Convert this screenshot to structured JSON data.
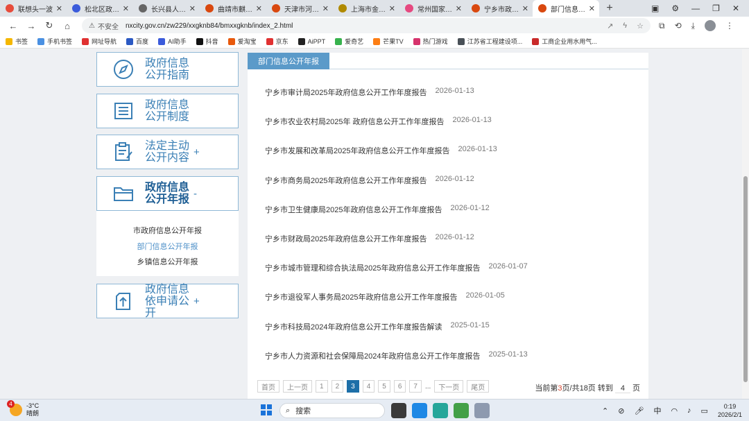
{
  "browser": {
    "tabs": [
      {
        "title": "联想头一波",
        "color": "#e74c3c"
      },
      {
        "title": "松北区政府办公",
        "color": "#3b5bdb"
      },
      {
        "title": "长兴县人民政府",
        "color": "#666666"
      },
      {
        "title": "曲靖市麒麟区",
        "color": "#d9480f"
      },
      {
        "title": "天津市河西区",
        "color": "#d9480f"
      },
      {
        "title": "上海市金山区",
        "color": "#b08a00"
      },
      {
        "title": "常州国家高新区",
        "color": "#e64980"
      },
      {
        "title": "宁乡市政府门户",
        "color": "#d9480f"
      },
      {
        "title": "部门信息公开年报",
        "color": "#d9480f",
        "active": true
      }
    ],
    "new_tab": "+",
    "address": {
      "insecure_label": "不安全",
      "url": "nxcity.gov.cn/zw229/xxgknb84/bmxxgknb/index_2.html"
    },
    "bookmarks": [
      {
        "label": "书签",
        "color": "#f5b700"
      },
      {
        "label": "手机书签",
        "color": "#4a90e2"
      },
      {
        "label": "网址导航",
        "color": "#e03131"
      },
      {
        "label": "百度",
        "color": "#2b59c3"
      },
      {
        "label": "AI助手",
        "color": "#3b5bdb"
      },
      {
        "label": "抖音",
        "color": "#111111"
      },
      {
        "label": "爱淘宝",
        "color": "#e8590c"
      },
      {
        "label": "京东",
        "color": "#e03131"
      },
      {
        "label": "AiPPT",
        "color": "#222222"
      },
      {
        "label": "爱奇艺",
        "color": "#37b24d"
      },
      {
        "label": "芒果TV",
        "color": "#fd7e14"
      },
      {
        "label": "热门游戏",
        "color": "#d6336c"
      },
      {
        "label": "江苏省工程建设项...",
        "color": "#495057"
      },
      {
        "label": "工商企业用水用气...",
        "color": "#c92a2a"
      }
    ]
  },
  "sidebar": {
    "items": [
      {
        "label": "政府信息公开指南",
        "toggle": ""
      },
      {
        "label": "政府信息公开制度",
        "toggle": ""
      },
      {
        "label": "法定主动公开内容",
        "toggle": "+"
      },
      {
        "label": "政府信息公开年报",
        "toggle": "-"
      },
      {
        "label": "政府信息依申请公开",
        "toggle": "+"
      }
    ],
    "sub_items": [
      {
        "label": "市政府信息公开年报"
      },
      {
        "label": "部门信息公开年报"
      },
      {
        "label": "乡镇信息公开年报"
      }
    ]
  },
  "main": {
    "tab_label": "部门信息公开年报",
    "items": [
      {
        "title": "宁乡市审计局2025年政府信息公开工作年度报告",
        "date": "2026-01-13"
      },
      {
        "title": "宁乡市农业农村局2025年 政府信息公开工作年度报告",
        "date": "2026-01-13"
      },
      {
        "title": "宁乡市发展和改革局2025年政府信息公开工作年度报告",
        "date": "2026-01-13"
      },
      {
        "title": "宁乡市商务局2025年政府信息公开工作年度报告",
        "date": "2026-01-12"
      },
      {
        "title": "宁乡市卫生健康局2025年政府信息公开工作年度报告",
        "date": "2026-01-12"
      },
      {
        "title": "宁乡市财政局2025年政府信息公开工作年度报告",
        "date": "2026-01-12"
      },
      {
        "title": "宁乡市城市管理和综合执法局2025年政府信息公开工作年度报告",
        "date": "2026-01-07"
      },
      {
        "title": "宁乡市退役军人事务局2025年政府信息公开工作年度报告",
        "date": "2026-01-05"
      },
      {
        "title": "宁乡市科技局2024年政府信息公开工作年度报告解读",
        "date": "2025-01-15"
      },
      {
        "title": "宁乡市人力资源和社会保障局2024年政府信息公开工作年度报告",
        "date": "2025-01-13"
      }
    ],
    "pager": {
      "first": "首页",
      "prev": "上一页",
      "pages": [
        "1",
        "2",
        "3",
        "4",
        "5",
        "6",
        "7"
      ],
      "current": "3",
      "ellipsis": "...",
      "next": "下一页",
      "last": "尾页",
      "info_pre": "当前第",
      "info_cur": "3",
      "info_mid": "页/共18页 转到",
      "jump_value": "4",
      "info_post": "页"
    }
  },
  "taskbar": {
    "weather_badge": "4",
    "temperature": "-3°C",
    "condition": "晴朗",
    "search_label": "搜索",
    "ime": "中",
    "time": "0:19",
    "date": "2026/2/1"
  }
}
